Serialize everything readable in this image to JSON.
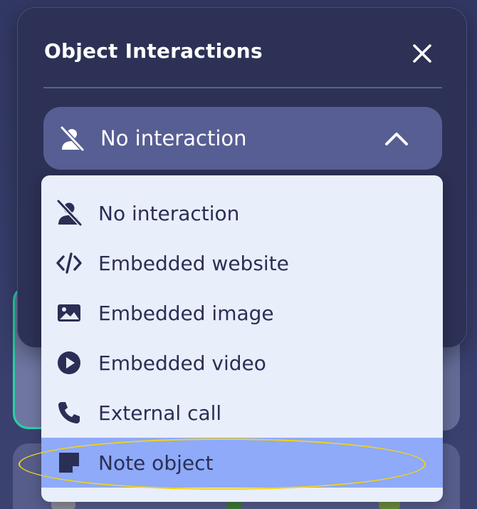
{
  "modal": {
    "title": "Object Interactions",
    "close_icon": "close-icon"
  },
  "select": {
    "current_label": "No interaction",
    "current_icon": "no-interaction-icon",
    "chevron_icon": "chevron-up-icon"
  },
  "options": [
    {
      "label": "No interaction",
      "icon": "no-interaction-icon"
    },
    {
      "label": "Embedded website",
      "icon": "code-icon"
    },
    {
      "label": "Embedded image",
      "icon": "image-icon"
    },
    {
      "label": "Embedded video",
      "icon": "play-icon"
    },
    {
      "label": "External call",
      "icon": "phone-icon"
    },
    {
      "label": "Note object",
      "icon": "note-icon",
      "selected": true
    }
  ],
  "colors": {
    "modal_bg": "#2c3155",
    "select_bg": "#575e93",
    "dropdown_bg": "#e9eefb",
    "selected_bg": "#8eaaf9",
    "annotation": "#f3d21a",
    "accent_teal": "#2ad0a8"
  }
}
